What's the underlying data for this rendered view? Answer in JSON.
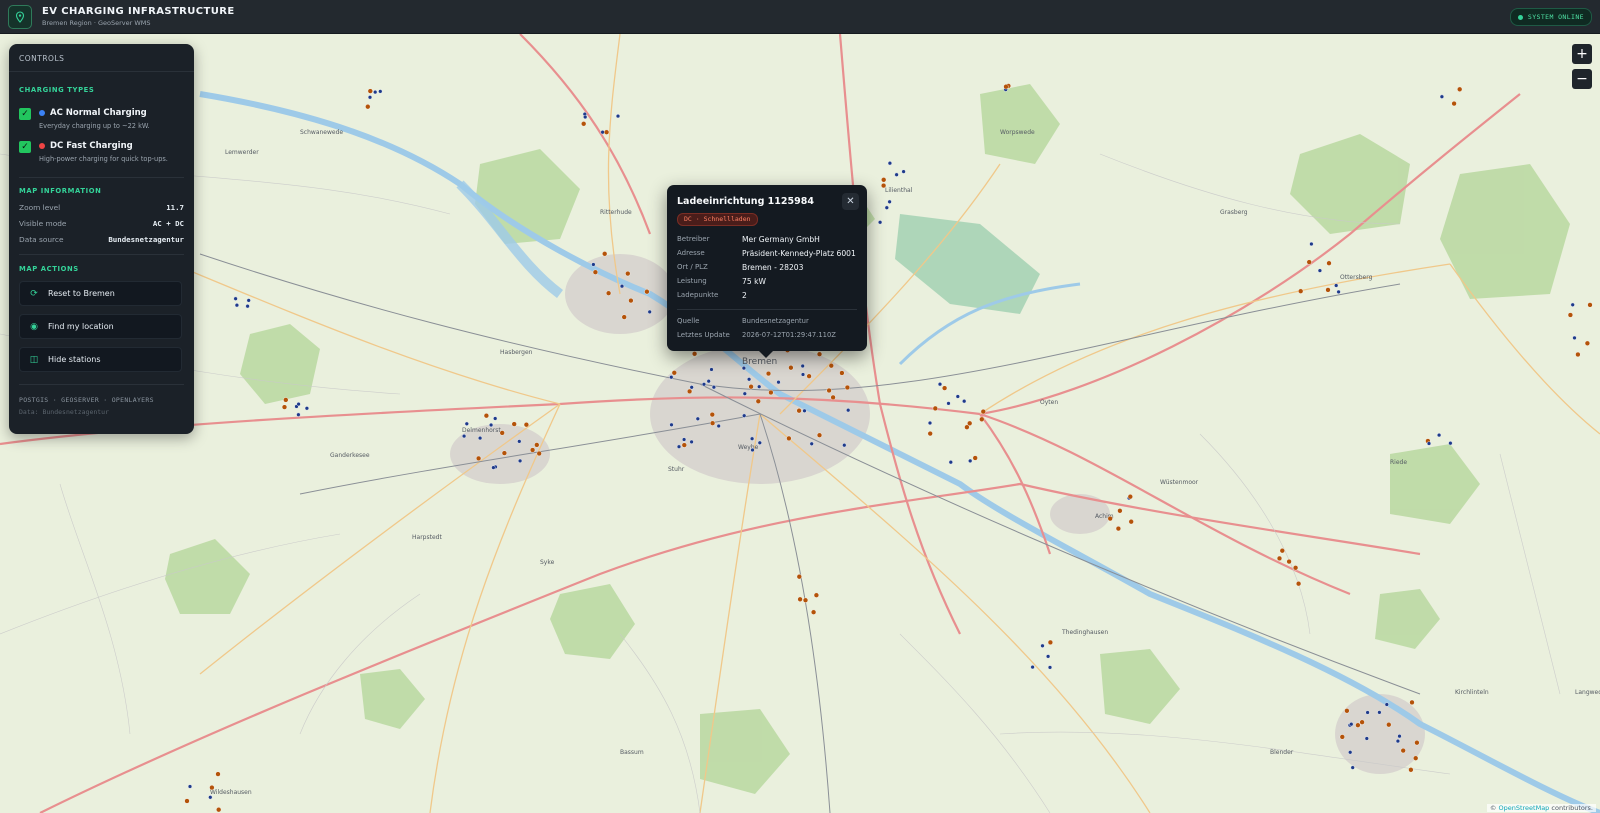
{
  "header": {
    "title": "EV CHARGING INFRASTRUCTURE",
    "subtitle": "Bremen Region · GeoServer WMS",
    "status": "SYSTEM ONLINE"
  },
  "zoom": {
    "in": "+",
    "out": "−"
  },
  "panel": {
    "title": "CONTROLS",
    "charging_types_title": "CHARGING TYPES",
    "ac": {
      "label": "AC Normal Charging",
      "desc": "Everyday charging up to ~22 kW.",
      "color": "#3b82f6",
      "checked": true
    },
    "dc": {
      "label": "DC Fast Charging",
      "desc": "High-power charging for quick top-ups.",
      "color": "#ef4444",
      "checked": true
    },
    "map_info_title": "MAP INFORMATION",
    "info": [
      {
        "label": "Zoom level",
        "value": "11.7"
      },
      {
        "label": "Visible mode",
        "value": "AC + DC"
      },
      {
        "label": "Data source",
        "value": "Bundesnetzagentur"
      }
    ],
    "map_actions_title": "MAP ACTIONS",
    "actions": [
      {
        "label": "Reset to Bremen",
        "icon": "refresh-icon"
      },
      {
        "label": "Find my location",
        "icon": "locate-icon"
      },
      {
        "label": "Hide stations",
        "icon": "layers-icon"
      }
    ],
    "footer_stack": "POSTGIS · GEOSERVER · OPENLAYERS",
    "footer_data": "Data: Bundesnetzagentur"
  },
  "popup": {
    "title": "Ladeeinrichtung 1125984",
    "badge": "DC · Schnellladen",
    "rows": [
      {
        "label": "Betreiber",
        "value": "Mer Germany GmbH"
      },
      {
        "label": "Adresse",
        "value": "Präsident-Kennedy-Platz 6001"
      },
      {
        "label": "Ort / PLZ",
        "value": "Bremen - 28203"
      },
      {
        "label": "Leistung",
        "value": "75 kW"
      },
      {
        "label": "Ladepunkte",
        "value": "2"
      }
    ],
    "meta": [
      {
        "label": "Quelle",
        "value": "Bundesnetzagentur"
      },
      {
        "label": "Letztes Update",
        "value": "2026-07-12T01:29:47.110Z"
      }
    ]
  },
  "map": {
    "place_labels": [
      "Bremen",
      "Delmenhorst",
      "Ganderkesee",
      "Lemwerder",
      "Stuhr",
      "Weyhe",
      "Achim",
      "Oyten",
      "Lilienthal",
      "Ritterhude",
      "Langwedel",
      "Thedinghausen",
      "Kirchlinteln",
      "Ottersberg",
      "Syke",
      "Wildeshausen",
      "Bassum",
      "Riede",
      "Harpstedt",
      "Grasberg",
      "Worpswede",
      "Schwanewede",
      "Berne",
      "Hude",
      "Hasbergen",
      "Wüstenmoor",
      "Blender"
    ],
    "colors": {
      "ac": "#1e3a8a",
      "dc": "#b45309"
    },
    "attribution_prefix": "© ",
    "attribution_link": "OpenStreetMap",
    "attribution_suffix": " contributors."
  }
}
